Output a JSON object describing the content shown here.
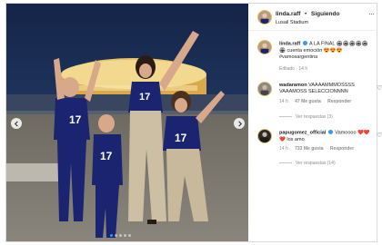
{
  "header": {
    "username": "linda.raff",
    "verified": true,
    "separator": "•",
    "follow_label": "Siguiendo",
    "location": "Lusail Stadium",
    "more_label": "···"
  },
  "caption": {
    "username": "linda.raff",
    "text": "A LA FINAL 🏟🏟🏟🏟🏟🏟 cuenta emoción 😍😍😍 #vamosargentina",
    "meta": "Editado · 14 h"
  },
  "comments": [
    {
      "username": "wadaramon",
      "text": "VAAAAMMMOSSSS VAAAMOSS SELECCIONNNN",
      "time": "14 h",
      "likes": "47 Me gusta",
      "reply_label": "Responder",
      "view_replies": "Ver respuestas (3)"
    },
    {
      "username": "papugomez_official",
      "verified": true,
      "text": "Vamoooo ❤️❤️❤️ los amo",
      "time": "14 h",
      "likes": "733 Me gusta",
      "reply_label": "Responder",
      "view_replies": "Ver respuestas (14)"
    }
  ],
  "carousel": {
    "slides": 5,
    "active_index": 0
  },
  "colors": {
    "accent": "#3897f0",
    "jersey": "#1a2470",
    "sky": "#1b2a4a",
    "text": "#262626",
    "muted": "#8e8e8e"
  },
  "icons": {
    "prev": "chevron-left-icon",
    "next": "chevron-right-icon",
    "like": "heart-icon",
    "more": "more-icon"
  }
}
